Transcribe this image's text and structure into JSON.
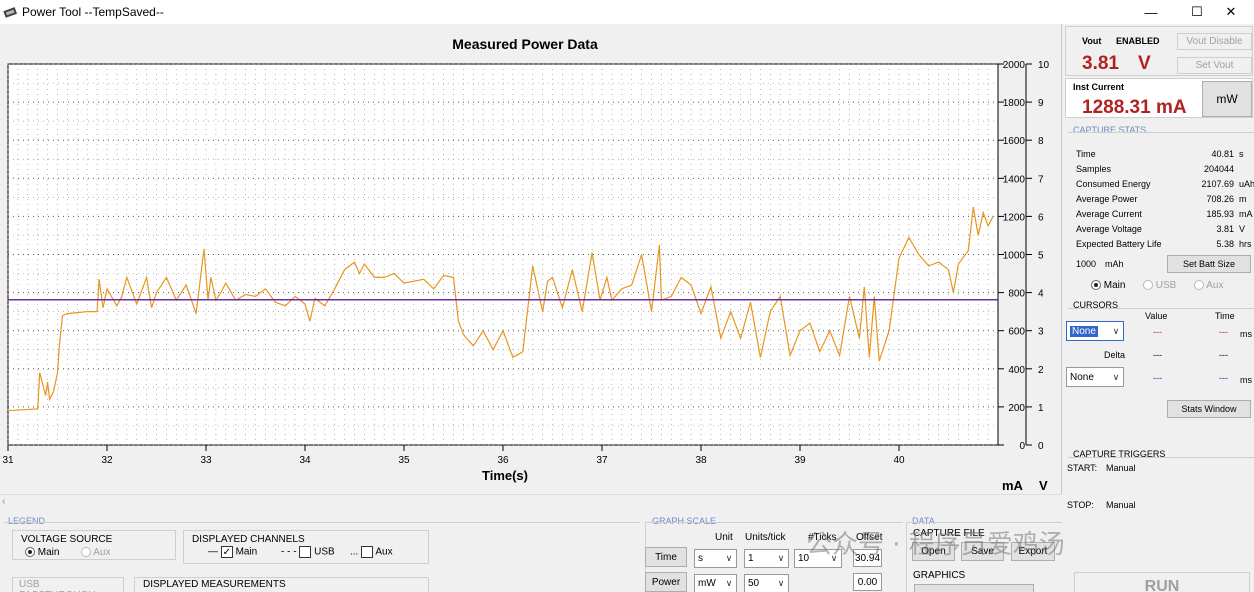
{
  "window": {
    "title": "Power Tool --TempSaved--",
    "minimize": "—",
    "maximize": "☐",
    "close": "✕"
  },
  "chart_data": {
    "type": "line",
    "title": "Measured Power Data",
    "xlabel": "Time(s)",
    "ylabel_left_unit": "mA",
    "ylabel_right_unit": "V",
    "xlim": [
      31,
      41
    ],
    "ylim_left": [
      0,
      2000
    ],
    "ylim_right": [
      0,
      10
    ],
    "x_ticks": [
      "31",
      "32",
      "33",
      "34",
      "35",
      "36",
      "37",
      "38",
      "39",
      "40"
    ],
    "y_ticks_left": [
      "0",
      "200",
      "400",
      "600",
      "800",
      "1000",
      "1200",
      "1400",
      "1600",
      "1800",
      "2000"
    ],
    "y_ticks_right": [
      "0",
      "1",
      "2",
      "3",
      "4",
      "5",
      "6",
      "7",
      "8",
      "9",
      "10"
    ],
    "grid": true,
    "series": [
      {
        "color": "#e8961e",
        "axis": "left",
        "x": [
          31.0,
          31.3,
          31.32,
          31.38,
          31.4,
          31.42,
          31.46,
          31.5,
          31.52,
          31.55,
          31.6,
          31.8,
          31.9,
          31.92,
          31.96,
          32.0,
          32.1,
          32.15,
          32.2,
          32.3,
          32.4,
          32.45,
          32.5,
          32.6,
          32.7,
          32.8,
          32.9,
          32.98,
          33.02,
          33.05,
          33.1,
          33.15,
          33.2,
          33.3,
          33.4,
          33.5,
          33.6,
          33.7,
          33.8,
          33.9,
          34.0,
          34.05,
          34.1,
          34.2,
          34.3,
          34.4,
          34.5,
          34.55,
          34.6,
          34.7,
          34.8,
          34.9,
          35.0,
          35.1,
          35.2,
          35.3,
          35.4,
          35.5,
          35.55,
          35.6,
          35.7,
          35.8,
          35.9,
          36.0,
          36.1,
          36.2,
          36.3,
          36.4,
          36.45,
          36.5,
          36.6,
          36.7,
          36.8,
          36.9,
          36.98,
          37.05,
          37.1,
          37.2,
          37.3,
          37.4,
          37.5,
          37.58,
          37.6,
          37.7,
          37.8,
          37.9,
          38.0,
          38.1,
          38.2,
          38.3,
          38.4,
          38.5,
          38.6,
          38.7,
          38.8,
          38.9,
          39.0,
          39.1,
          39.2,
          39.3,
          39.4,
          39.5,
          39.6,
          39.65,
          39.7,
          39.75,
          39.8,
          39.9,
          40.0,
          40.1,
          40.2,
          40.3,
          40.4,
          40.5,
          40.55,
          40.6,
          40.7,
          40.75,
          40.8,
          40.85,
          40.9,
          40.95
        ],
        "values": [
          180,
          190,
          380,
          260,
          330,
          240,
          280,
          380,
          530,
          680,
          690,
          700,
          700,
          870,
          720,
          820,
          730,
          780,
          880,
          740,
          880,
          720,
          800,
          880,
          760,
          840,
          690,
          1030,
          760,
          880,
          760,
          800,
          850,
          760,
          790,
          780,
          820,
          750,
          730,
          780,
          740,
          650,
          770,
          730,
          820,
          920,
          960,
          900,
          950,
          880,
          880,
          900,
          850,
          860,
          870,
          820,
          890,
          880,
          650,
          580,
          520,
          600,
          500,
          600,
          460,
          490,
          940,
          700,
          860,
          880,
          720,
          920,
          700,
          1010,
          760,
          880,
          760,
          820,
          840,
          1000,
          700,
          1050,
          760,
          780,
          880,
          840,
          690,
          830,
          560,
          700,
          560,
          750,
          460,
          700,
          780,
          470,
          600,
          640,
          490,
          600,
          470,
          780,
          560,
          830,
          460,
          780,
          440,
          600,
          980,
          1090,
          1000,
          940,
          960,
          920,
          800,
          950,
          1020,
          1250,
          1100,
          1220,
          1150,
          1200
        ]
      },
      {
        "color": "#6a2ca8",
        "axis": "left",
        "x": [
          31.0,
          41.0
        ],
        "values": [
          762,
          762
        ]
      }
    ]
  },
  "right": {
    "vout_label": "Vout",
    "vout_status": "ENABLED",
    "vout_value": "3.81",
    "vout_unit": "V",
    "vout_disable": "Vout Disable",
    "set_vout": "Set Vout",
    "inst_label": "Inst Current",
    "inst_value": "1288.31 mA",
    "mw_button": "mW",
    "capture_stats_title": "CAPTURE STATS",
    "stats": [
      {
        "label": "Time",
        "value": "40.81",
        "unit": "s"
      },
      {
        "label": "Samples",
        "value": "204044",
        "unit": ""
      },
      {
        "label": "Consumed Energy",
        "value": "2107.69",
        "unit": "uAh"
      },
      {
        "label": "Average Power",
        "value": "708.26",
        "unit": "m"
      },
      {
        "label": "Average Current",
        "value": "185.93",
        "unit": "mA"
      },
      {
        "label": "Average Voltage",
        "value": "3.81",
        "unit": "V"
      },
      {
        "label": "Expected Battery Life",
        "value": "5.38",
        "unit": "hrs"
      }
    ],
    "batt_value": "1000",
    "batt_unit": "mAh",
    "set_batt": "Set Batt Size",
    "src_main": "Main",
    "src_usb": "USB",
    "src_aux": "Aux",
    "cursors_title": "CURSORS",
    "col_value": "Value",
    "col_time": "Time",
    "cursor1_select": "None",
    "cursor1_value": "---",
    "cursor1_time": "---",
    "ms1": "ms",
    "delta_label": "Delta",
    "delta_value": "---",
    "delta_time": "---",
    "cursor2_select": "None",
    "cursor2_value": "---",
    "cursor2_time": "---",
    "ms2": "ms",
    "stats_window": "Stats Window",
    "triggers_title": "CAPTURE TRIGGERS",
    "start_label": "START:",
    "start_value": "Manual",
    "stop_label": "STOP:",
    "stop_value": "Manual",
    "run_button": "RUN"
  },
  "bottom": {
    "legend_title": "LEGEND",
    "voltage_source_title": "VOLTAGE SOURCE",
    "vs_main": "Main",
    "vs_aux": "Aux",
    "displayed_channels_title": "DISPLAYED CHANNELS",
    "ch_main": "Main",
    "ch_usb": "USB",
    "ch_aux": "Aux",
    "usb_passthrough_title": "USB PASSTHROUGH",
    "displayed_measurements_title": "DISPLAYED MEASUREMENTS",
    "graph_scale_title": "GRAPH SCALE",
    "col_unit": "Unit",
    "col_units_tick": "Units/tick",
    "col_ticks": "#Ticks",
    "col_offset": "Offset",
    "time_button": "Time",
    "time_unit": "s",
    "time_units_tick": "1",
    "time_ticks": "10",
    "time_offset": "30.94",
    "power_button": "Power",
    "power_unit": "mW",
    "power_units_tick": "50",
    "power_offset": "0.00",
    "data_title": "DATA",
    "capture_file_title": "CAPTURE FILE",
    "open_button": "Open",
    "save_button": "Save",
    "export_button": "Export",
    "graphics_title": "GRAPHICS"
  },
  "watermark": "公众号 · 程序员爱鸡汤",
  "colors": {
    "accent_red": "#b22222",
    "section_blue": "#6a8cc7",
    "current_line": "#e8961e",
    "voltage_line": "#6a2ca8"
  }
}
